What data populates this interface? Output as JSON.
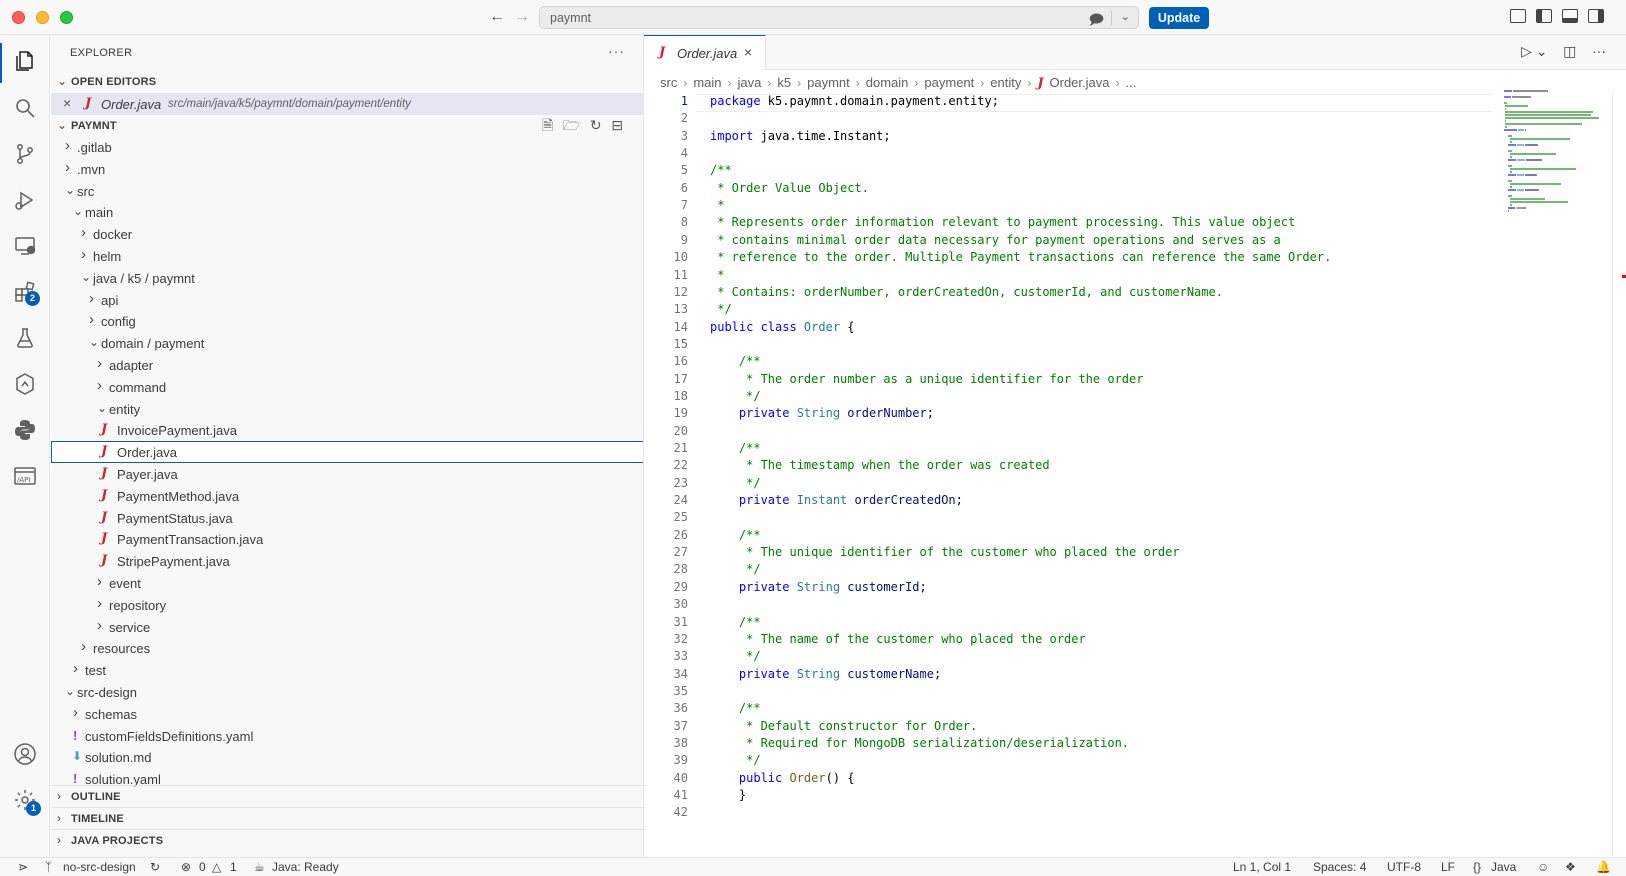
{
  "window": {
    "command_center_text": "paymnt",
    "update_label": "Update"
  },
  "activity_bar": {
    "extensions_badge": "2",
    "settings_badge": "1"
  },
  "sidebar": {
    "title": "EXPLORER",
    "more_label": "···",
    "open_editors_label": "OPEN EDITORS",
    "open_editor": {
      "name": "Order.java",
      "path": "src/main/java/k5/paymnt/domain/payment/entity"
    },
    "project_label": "PAYMNT",
    "tree": [
      {
        "label": ".gitlab",
        "type": "folder",
        "state": "collapsed",
        "depth": 0
      },
      {
        "label": ".mvn",
        "type": "folder",
        "state": "collapsed",
        "depth": 0
      },
      {
        "label": "src",
        "type": "folder",
        "state": "expanded",
        "depth": 0
      },
      {
        "label": "main",
        "type": "folder",
        "state": "expanded",
        "depth": 1
      },
      {
        "label": "docker",
        "type": "folder",
        "state": "collapsed",
        "depth": 2
      },
      {
        "label": "helm",
        "type": "folder",
        "state": "collapsed",
        "depth": 2
      },
      {
        "label": "java / k5 / paymnt",
        "type": "folder",
        "state": "expanded",
        "depth": 2
      },
      {
        "label": "api",
        "type": "folder",
        "state": "collapsed",
        "depth": 3
      },
      {
        "label": "config",
        "type": "folder",
        "state": "collapsed",
        "depth": 3
      },
      {
        "label": "domain / payment",
        "type": "folder",
        "state": "expanded",
        "depth": 3
      },
      {
        "label": "adapter",
        "type": "folder",
        "state": "collapsed",
        "depth": 4
      },
      {
        "label": "command",
        "type": "folder",
        "state": "collapsed",
        "depth": 4
      },
      {
        "label": "entity",
        "type": "folder",
        "state": "expanded",
        "depth": 4
      },
      {
        "label": "InvoicePayment.java",
        "type": "java",
        "depth": 5
      },
      {
        "label": "Order.java",
        "type": "java",
        "depth": 5,
        "selected": true
      },
      {
        "label": "Payer.java",
        "type": "java",
        "depth": 5
      },
      {
        "label": "PaymentMethod.java",
        "type": "java",
        "depth": 5
      },
      {
        "label": "PaymentStatus.java",
        "type": "java",
        "depth": 5
      },
      {
        "label": "PaymentTransaction.java",
        "type": "java",
        "depth": 5
      },
      {
        "label": "StripePayment.java",
        "type": "java",
        "depth": 5
      },
      {
        "label": "event",
        "type": "folder",
        "state": "collapsed",
        "depth": 4
      },
      {
        "label": "repository",
        "type": "folder",
        "state": "collapsed",
        "depth": 4
      },
      {
        "label": "service",
        "type": "folder",
        "state": "collapsed",
        "depth": 4
      },
      {
        "label": "resources",
        "type": "folder",
        "state": "collapsed",
        "depth": 2
      },
      {
        "label": "test",
        "type": "folder",
        "state": "collapsed",
        "depth": 1
      },
      {
        "label": "src-design",
        "type": "folder",
        "state": "expanded",
        "depth": 0
      },
      {
        "label": "schemas",
        "type": "folder",
        "state": "collapsed",
        "depth": 1
      },
      {
        "label": "customFieldsDefinitions.yaml",
        "type": "yaml",
        "depth": 1
      },
      {
        "label": "solution.md",
        "type": "md",
        "depth": 1
      },
      {
        "label": "solution.yaml",
        "type": "yaml",
        "depth": 1
      }
    ],
    "outline_label": "OUTLINE",
    "timeline_label": "TIMELINE",
    "java_projects_label": "JAVA PROJECTS"
  },
  "editor": {
    "tab_label": "Order.java",
    "breadcrumb": [
      "src",
      "main",
      "java",
      "k5",
      "paymnt",
      "domain",
      "payment",
      "entity"
    ],
    "breadcrumb_file": "Order.java",
    "breadcrumb_more": "...",
    "lines": [
      [
        [
          "kw",
          "package "
        ],
        [
          "pl",
          "k5.paymnt.domain.payment.entity;"
        ]
      ],
      [],
      [
        [
          "kw",
          "import "
        ],
        [
          "pl",
          "java.time.Instant;"
        ]
      ],
      [],
      [
        [
          "cm",
          "/**"
        ]
      ],
      [
        [
          "cm",
          " * Order Value Object."
        ]
      ],
      [
        [
          "cm",
          " *"
        ]
      ],
      [
        [
          "cm",
          " * Represents order information relevant to payment processing. This value object"
        ]
      ],
      [
        [
          "cm",
          " * contains minimal order data necessary for payment operations and serves as a"
        ]
      ],
      [
        [
          "cm",
          " * reference to the order. Multiple Payment transactions can reference the same Order."
        ]
      ],
      [
        [
          "cm",
          " *"
        ]
      ],
      [
        [
          "cm",
          " * Contains: orderNumber, orderCreatedOn, customerId, and customerName."
        ]
      ],
      [
        [
          "cm",
          " */"
        ]
      ],
      [
        [
          "kw",
          "public class "
        ],
        [
          "ty",
          "Order"
        ],
        [
          "pl",
          " {"
        ]
      ],
      [],
      [
        [
          "cm",
          "    /**"
        ]
      ],
      [
        [
          "cm",
          "     * The order number as a unique identifier for the order"
        ]
      ],
      [
        [
          "cm",
          "     */"
        ]
      ],
      [
        [
          "kw",
          "    private "
        ],
        [
          "ty",
          "String "
        ],
        [
          "id",
          "orderNumber"
        ],
        [
          "pl",
          ";"
        ]
      ],
      [],
      [
        [
          "cm",
          "    /**"
        ]
      ],
      [
        [
          "cm",
          "     * The timestamp when the order was created"
        ]
      ],
      [
        [
          "cm",
          "     */"
        ]
      ],
      [
        [
          "kw",
          "    private "
        ],
        [
          "ty",
          "Instant "
        ],
        [
          "id",
          "orderCreatedOn"
        ],
        [
          "pl",
          ";"
        ]
      ],
      [],
      [
        [
          "cm",
          "    /**"
        ]
      ],
      [
        [
          "cm",
          "     * The unique identifier of the customer who placed the order"
        ]
      ],
      [
        [
          "cm",
          "     */"
        ]
      ],
      [
        [
          "kw",
          "    private "
        ],
        [
          "ty",
          "String "
        ],
        [
          "id",
          "customerId"
        ],
        [
          "pl",
          ";"
        ]
      ],
      [],
      [
        [
          "cm",
          "    /**"
        ]
      ],
      [
        [
          "cm",
          "     * The name of the customer who placed the order"
        ]
      ],
      [
        [
          "cm",
          "     */"
        ]
      ],
      [
        [
          "kw",
          "    private "
        ],
        [
          "ty",
          "String "
        ],
        [
          "id",
          "customerName"
        ],
        [
          "pl",
          ";"
        ]
      ],
      [],
      [
        [
          "cm",
          "    /**"
        ]
      ],
      [
        [
          "cm",
          "     * Default constructor for Order."
        ]
      ],
      [
        [
          "cm",
          "     * Required for MongoDB serialization/deserialization."
        ]
      ],
      [
        [
          "cm",
          "     */"
        ]
      ],
      [
        [
          "kw",
          "    public "
        ],
        [
          "fn",
          "Order"
        ],
        [
          "pl",
          "() {"
        ]
      ],
      [
        [
          "pl",
          "    }"
        ]
      ],
      []
    ]
  },
  "statusbar": {
    "branch": "no-src-design",
    "errors": "0",
    "warnings": "1",
    "java_status": "Java: Ready",
    "cursor_position": "Ln 1, Col 1",
    "spaces": "Spaces: 4",
    "encoding": "UTF-8",
    "eol": "LF",
    "language": "Java"
  }
}
